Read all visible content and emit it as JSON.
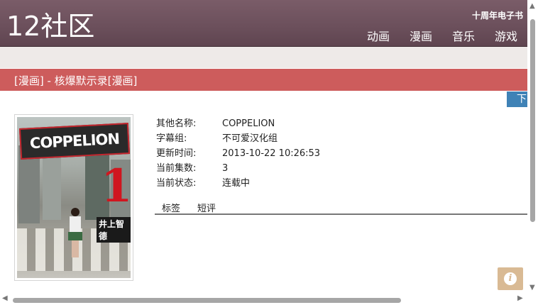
{
  "header": {
    "logo": "12社区",
    "ebook_link": "十周年电子书",
    "nav": [
      "动画",
      "漫画",
      "音乐",
      "游戏"
    ]
  },
  "page_title": "[漫画] - 核爆默示录[漫画]",
  "download_label": "下",
  "cover": {
    "logo_text": "COPPELION",
    "volume": "1",
    "author": "井上智德"
  },
  "info": [
    {
      "label": "其他名称:",
      "value": "COPPELION"
    },
    {
      "label": "字幕组:",
      "value": "不可爱汉化组"
    },
    {
      "label": "更新时间:",
      "value": "2013-10-22 10:26:53"
    },
    {
      "label": "当前集数:",
      "value": "3"
    },
    {
      "label": "当前状态:",
      "value": "连载中"
    }
  ],
  "tabs": [
    "标签",
    "短评"
  ],
  "colors": {
    "header_bg": "#6b4f5b",
    "title_bar": "#cd5c5c",
    "download_btn": "#3f82b6",
    "info_button": "#d9ba94"
  },
  "icons": {
    "info_button": "info-icon"
  }
}
